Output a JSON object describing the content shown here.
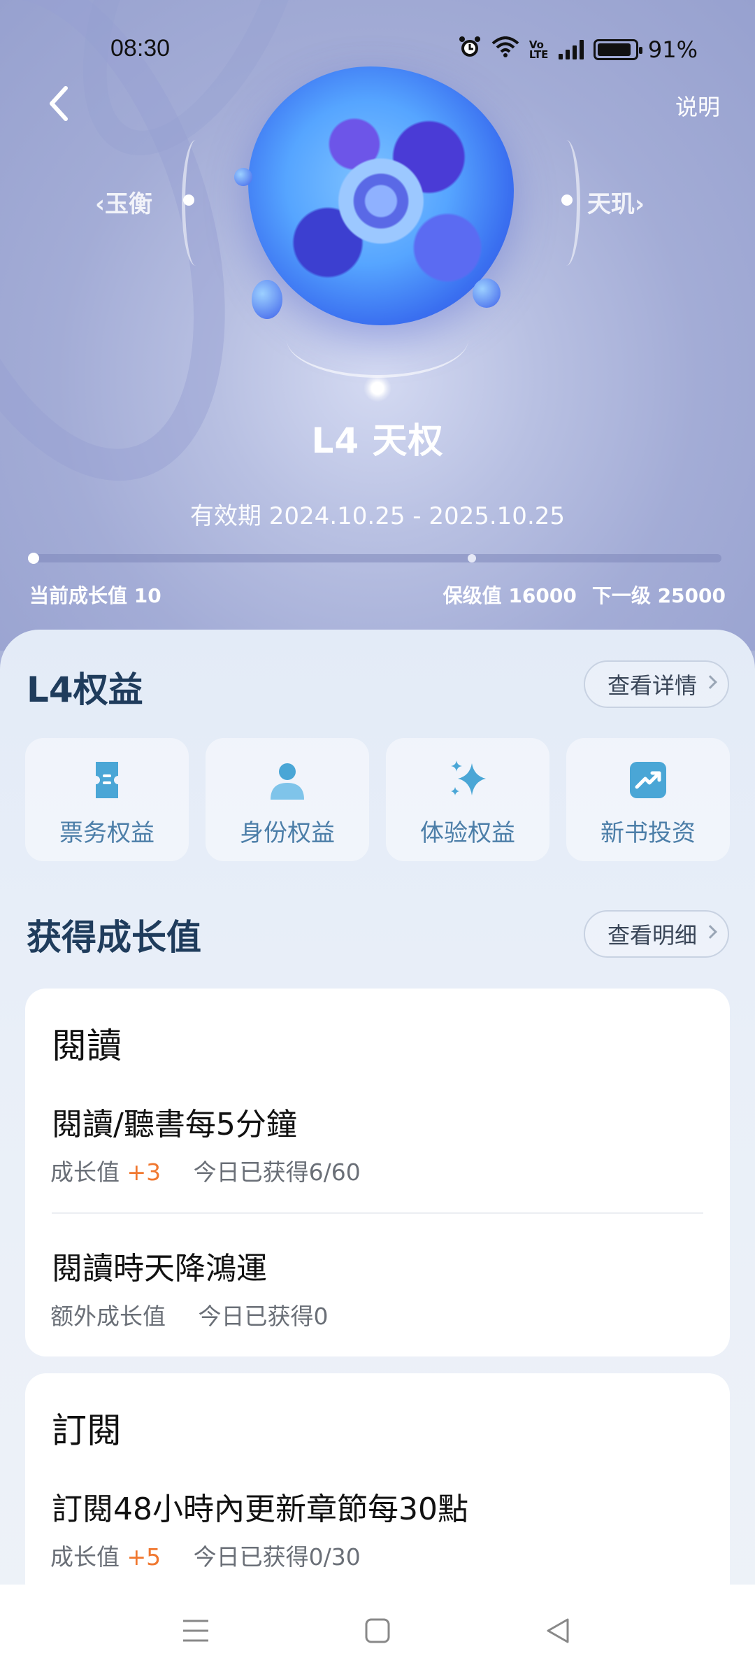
{
  "status_bar": {
    "time": "08:30",
    "battery": "91%",
    "network_label": "Vo LTE"
  },
  "header": {
    "explain_label": "说明"
  },
  "levels": {
    "prev": "玉衡",
    "next": "天玑",
    "current_title": "L4 天权"
  },
  "validity": "有效期 2024.10.25 - 2025.10.25",
  "progress": {
    "current_label": "当前成长值 10",
    "keep_label": "保级值 16000",
    "next_label": "下一级 25000",
    "current_value": 10,
    "keep_value": 16000,
    "next_value": 25000
  },
  "benefits_section": {
    "title": "L4权益",
    "detail_button": "查看详情",
    "items": [
      {
        "label": "票务权益",
        "icon": "ticket-icon"
      },
      {
        "label": "身份权益",
        "icon": "person-icon"
      },
      {
        "label": "体验权益",
        "icon": "sparkle-icon"
      },
      {
        "label": "新书投资",
        "icon": "trend-up-icon"
      }
    ]
  },
  "growth_section": {
    "title": "获得成长值",
    "detail_button": "查看明细",
    "cards": [
      {
        "title": "閱讀",
        "items": [
          {
            "title": "閱讀/聽書每5分鐘",
            "prefix": "成长值",
            "plus": "+3",
            "today": "今日已获得6/60"
          },
          {
            "title": "閱讀時天降鴻運",
            "prefix": "额外成长值",
            "plus": "",
            "today": "今日已获得0"
          }
        ]
      },
      {
        "title": "訂閱",
        "items": [
          {
            "title": "訂閱48小時內更新章節每30點",
            "prefix": "成长值",
            "plus": "+5",
            "today": "今日已获得0/30"
          }
        ]
      }
    ]
  },
  "colors": {
    "accent_plus": "#f0772f",
    "section_heading": "#1f3c5c",
    "benefit_label": "#4c7ea8",
    "icon_blue": "#4aa6d6"
  }
}
